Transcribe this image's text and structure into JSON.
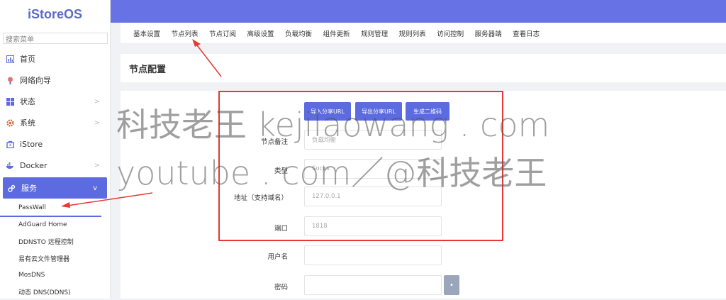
{
  "app": {
    "logo": "iStoreOS"
  },
  "sidebar": {
    "search_placeholder": "搜索菜单",
    "items": [
      {
        "label": "首页",
        "icon": "dashboard-icon"
      },
      {
        "label": "网络向导",
        "icon": "wizard-icon"
      },
      {
        "label": "状态",
        "icon": "status-icon",
        "chevron": ">"
      },
      {
        "label": "系统",
        "icon": "gear-icon",
        "chevron": ">"
      },
      {
        "label": "iStore",
        "icon": "store-icon"
      },
      {
        "label": "Docker",
        "icon": "docker-icon",
        "chevron": ">"
      },
      {
        "label": "服务",
        "icon": "services-icon",
        "chevron": "v",
        "active": true
      }
    ],
    "subitems": [
      {
        "label": "PassWall",
        "active": true
      },
      {
        "label": "AdGuard Home"
      },
      {
        "label": "DDNSTO 远程控制"
      },
      {
        "label": "易有云文件管理器"
      },
      {
        "label": "MosDNS"
      },
      {
        "label": "动态 DNS(DDNS)"
      }
    ]
  },
  "tabs": [
    "基本设置",
    "节点列表",
    "节点订阅",
    "高级设置",
    "负载均衡",
    "组件更新",
    "规则管理",
    "规则列表",
    "访问控制",
    "服务器端",
    "查看日志"
  ],
  "page": {
    "title": "节点配置"
  },
  "buttons": {
    "import": "导入分享URL",
    "export": "导出分享URL",
    "qrcode": "生成二维码"
  },
  "form": {
    "remarks": {
      "label": "节点备注",
      "value": "负载均衡"
    },
    "type": {
      "label": "类型",
      "value": "Socks"
    },
    "address": {
      "label": "地址（支持域名）",
      "placeholder": "127.0.0.1"
    },
    "port": {
      "label": "端口",
      "placeholder": "1818"
    },
    "username": {
      "label": "用户名",
      "value": ""
    },
    "password": {
      "label": "密码",
      "value": "",
      "toggle": "•"
    }
  },
  "watermark": {
    "line1": "科技老王 kejilaowang . com",
    "line2": "youtube . com／@科技老王"
  },
  "colors": {
    "accent": "#6772e5",
    "annotation": "#e53935"
  }
}
